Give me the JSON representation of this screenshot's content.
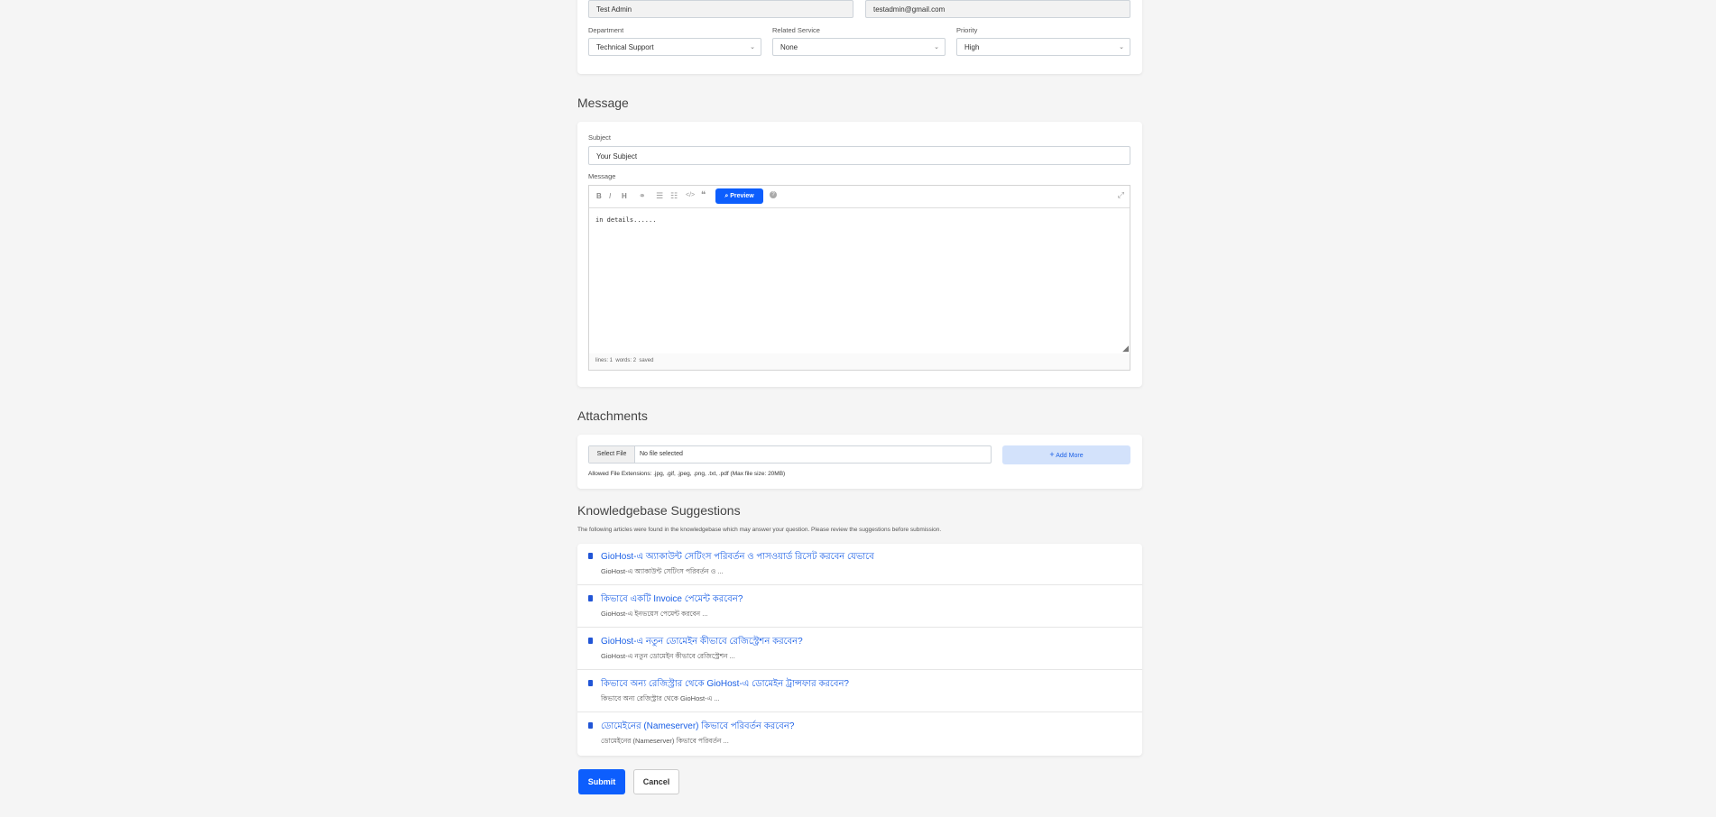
{
  "top_form": {
    "name_value": "Test Admin",
    "email_value": "testadmin@gmail.com",
    "department_label": "Department",
    "department_value": "Technical Support",
    "related_service_label": "Related Service",
    "related_service_value": "None",
    "priority_label": "Priority",
    "priority_value": "High"
  },
  "message_section": {
    "heading": "Message",
    "subject_label": "Subject",
    "subject_value": "Your Subject",
    "message_label": "Message",
    "preview_label": "Preview",
    "editor_text": "in details......",
    "status_lines": "lines: 1",
    "status_words": "words: 2",
    "status_saved": "saved"
  },
  "attachments": {
    "heading": "Attachments",
    "select_file_label": "Select File",
    "no_file_text": "No file selected",
    "add_more_label": "Add More",
    "allowed_text": "Allowed File Extensions: .jpg, .gif, .jpeg, .png, .txt, .pdf (Max file size: 20MB)"
  },
  "kb": {
    "heading": "Knowledgebase Suggestions",
    "intro": "The following articles were found in the knowledgebase which may answer your question. Please review the suggestions before submission.",
    "items": [
      {
        "title": "GioHost-এ অ্যাকাউন্ট সেটিংস পরিবর্তন ও পাসওয়ার্ড রিসেট করবেন যেভাবে",
        "excerpt": "GioHost-এ অ্যাকাউন্ট সেটিংস পরিবর্তন ও ..."
      },
      {
        "title": "কিভাবে একটি Invoice পেমেন্ট করবেন?",
        "excerpt": "GioHost-এ ইনভয়েস পেমেন্ট করবেন ..."
      },
      {
        "title": "GioHost-এ নতুন ডোমেইন কীভাবে রেজিস্ট্রেশন করবেন?",
        "excerpt": "GioHost-এ নতুন ডোমেইন কীভাবে রেজিস্ট্রেশন ..."
      },
      {
        "title": "কিভাবে অন্য রেজিস্ট্রার থেকে GioHost-এ ডোমেইন ট্রান্সফার করবেন?",
        "excerpt": "কিভাবে অন্য রেজিস্ট্রার থেকে GioHost-এ ..."
      },
      {
        "title": "ডোমেইনের (Nameserver) কিভাবে পরিবর্তন করবেন?",
        "excerpt": "ডোমেইনের (Nameserver) কিভাবে পরিবর্তন ..."
      }
    ]
  },
  "actions": {
    "submit_label": "Submit",
    "cancel_label": "Cancel"
  },
  "colors": {
    "primary": "#0d5efd",
    "add_more_bg": "#d3e2fb",
    "link": "#1a5fe6"
  }
}
